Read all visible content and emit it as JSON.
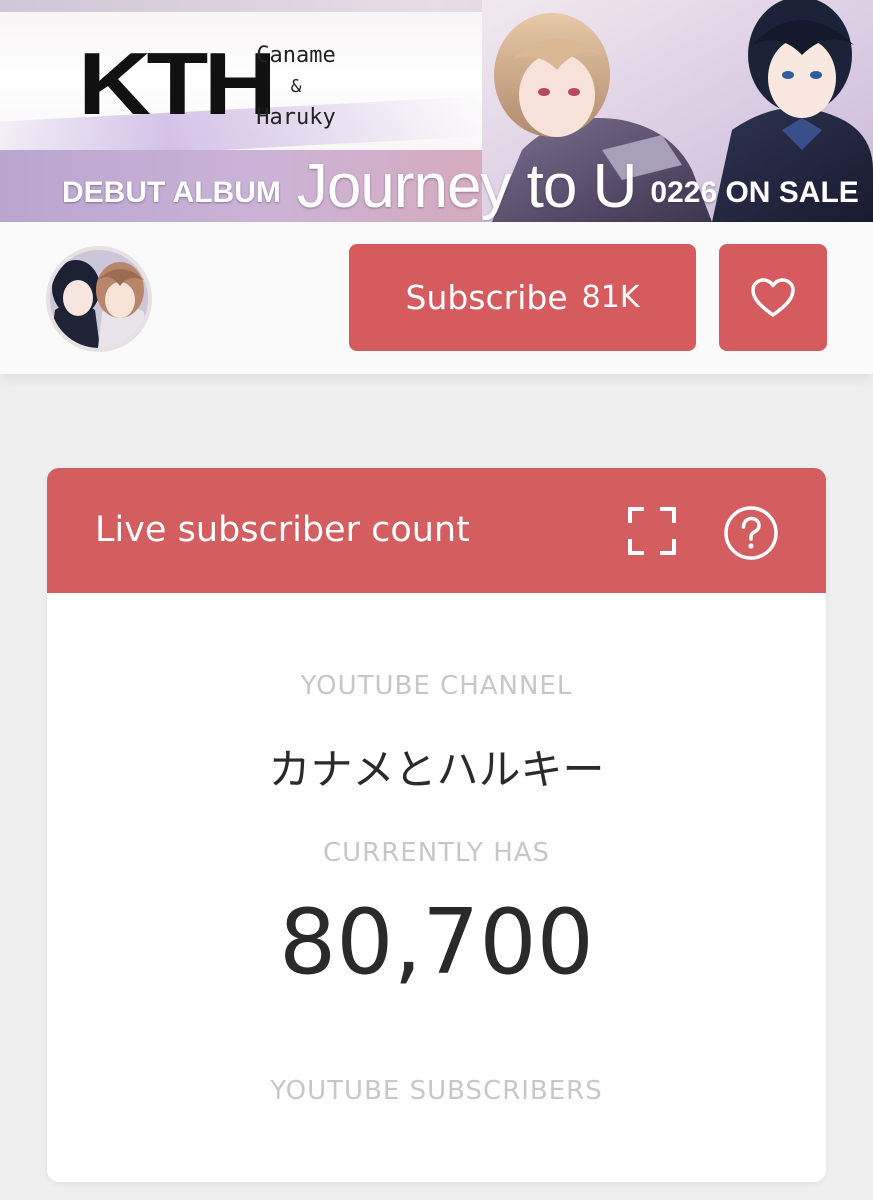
{
  "banner": {
    "logo_mark": "KTH",
    "logo_lines": [
      "Caname",
      "&",
      "Haruky"
    ],
    "album_label": "DEBUT ALBUM",
    "album_title": "Journey to U",
    "release": "0226 ON SALE"
  },
  "header": {
    "subscribe_label": "Subscribe",
    "subscribe_count": "81K",
    "favorite_icon": "heart-icon"
  },
  "card": {
    "title": "Live subscriber count",
    "fullscreen_icon": "fullscreen-icon",
    "help_icon": "help-icon",
    "channel_label": "YOUTUBE CHANNEL",
    "channel_name": "カナメとハルキー",
    "currently_label": "CURRENTLY HAS",
    "subscriber_count": "80,700",
    "subscribers_label": "YOUTUBE SUBSCRIBERS"
  },
  "colors": {
    "accent": "#d65b5e",
    "background": "#efefef",
    "muted_label": "#c7c7c7",
    "text": "#2a2a2a"
  }
}
